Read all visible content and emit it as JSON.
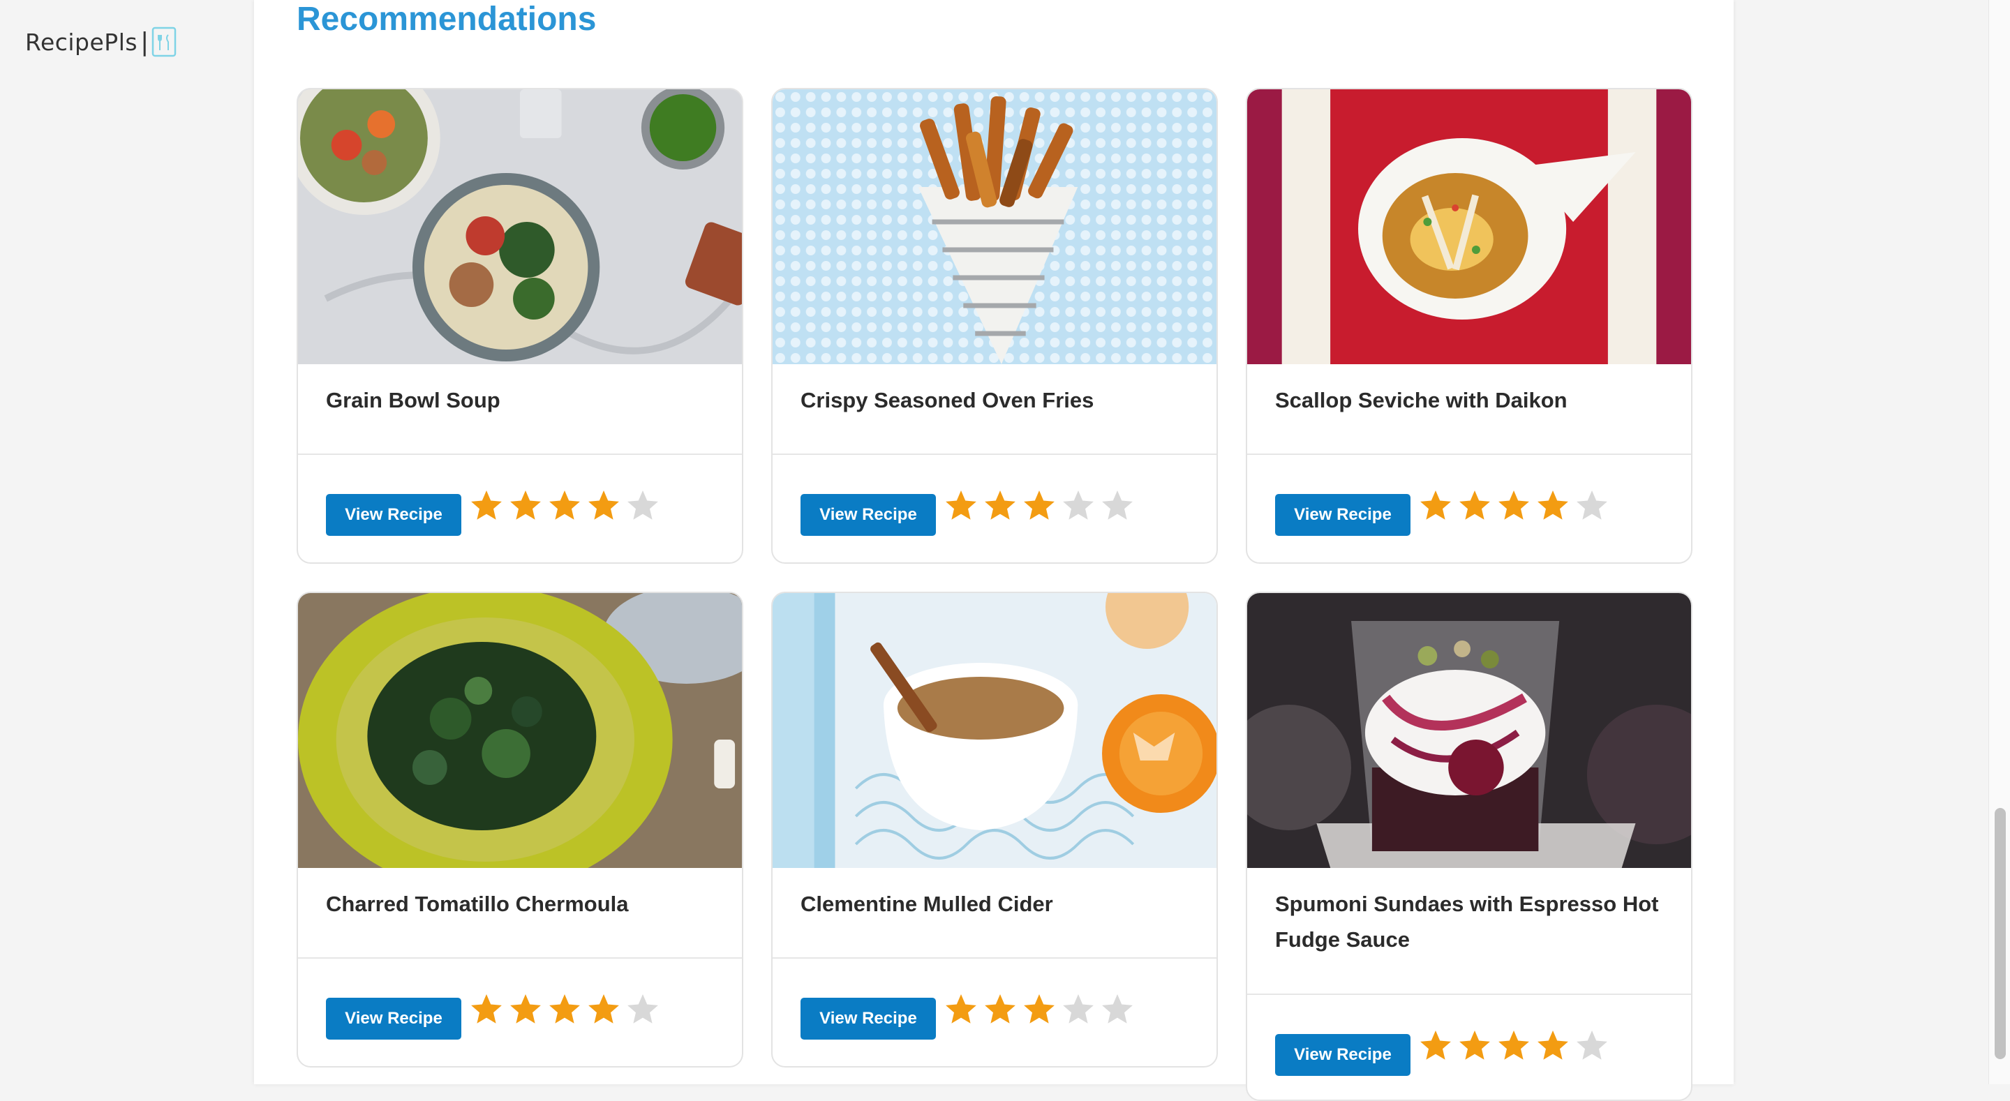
{
  "app": {
    "logo_text": "RecipePls",
    "logo_separator": "|"
  },
  "section": {
    "title": "Recommendations"
  },
  "colors": {
    "accent": "#2b95d6",
    "button": "#0a7cc4",
    "star_filled": "#f39c12",
    "star_empty": "#d8d8d8"
  },
  "recipes": [
    {
      "title": "Grain Bowl Soup",
      "button_label": "View Recipe",
      "rating": 4,
      "max_rating": 5,
      "image_icon": "grain-bowl-soup-photo"
    },
    {
      "title": "Crispy Seasoned Oven Fries",
      "button_label": "View Recipe",
      "rating": 3,
      "max_rating": 5,
      "image_icon": "oven-fries-photo"
    },
    {
      "title": "Scallop Seviche with Daikon",
      "button_label": "View Recipe",
      "rating": 4,
      "max_rating": 5,
      "image_icon": "scallop-seviche-photo"
    },
    {
      "title": "Charred Tomatillo Chermoula",
      "button_label": "View Recipe",
      "rating": 4,
      "max_rating": 5,
      "image_icon": "chermoula-photo"
    },
    {
      "title": "Clementine Mulled Cider",
      "button_label": "View Recipe",
      "rating": 3,
      "max_rating": 5,
      "image_icon": "mulled-cider-photo"
    },
    {
      "title": "Spumoni Sundaes with Espresso Hot Fudge Sauce",
      "button_label": "View Recipe",
      "rating": 4,
      "max_rating": 5,
      "image_icon": "spumoni-sundae-photo"
    }
  ]
}
